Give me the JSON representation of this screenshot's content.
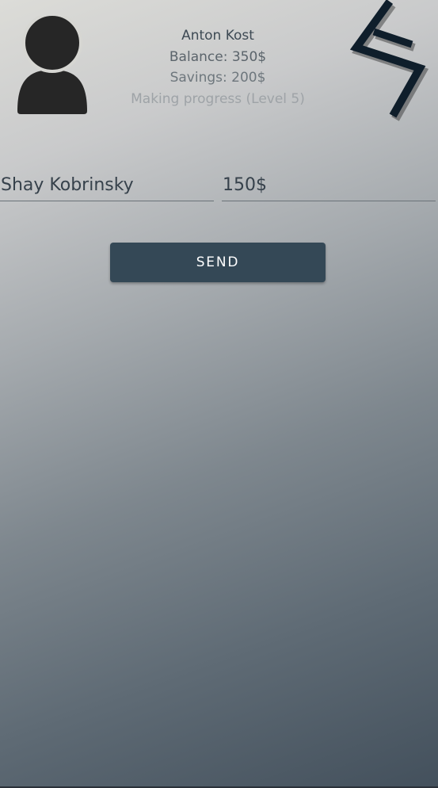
{
  "profile": {
    "name": "Anton Kost",
    "balance": "Balance: 350$",
    "savings": "Savings: 200$",
    "level": "Making progress (Level 5)"
  },
  "form": {
    "recipient_value": "Shay Kobrinsky",
    "amount_value": "150$",
    "send_label": "SEND"
  },
  "icons": {
    "avatar": "user-silhouette-icon",
    "logo": "brand-logo-icon"
  },
  "colors": {
    "button": "#344856",
    "text_primary": "#3e4a54",
    "logo": "#0f1e2b"
  }
}
